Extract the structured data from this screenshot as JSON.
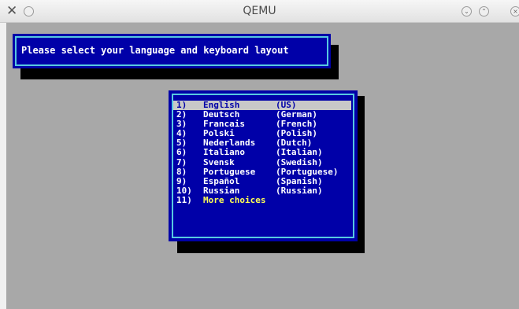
{
  "window": {
    "title": "QEMU",
    "icons": [
      "close-icon",
      "minimize-circle-icon",
      "chevron-down-icon",
      "chevron-up-icon",
      "close-circle-icon"
    ]
  },
  "header": {
    "prompt": "Please select your language and keyboard layout"
  },
  "menu": {
    "selected_index": 0,
    "items": [
      {
        "number": "1)",
        "label": "English",
        "detail": "(US)"
      },
      {
        "number": "2)",
        "label": "Deutsch",
        "detail": "(German)"
      },
      {
        "number": "3)",
        "label": "Francais",
        "detail": "(French)"
      },
      {
        "number": "4)",
        "label": "Polski",
        "detail": "(Polish)"
      },
      {
        "number": "5)",
        "label": "Nederlands",
        "detail": "(Dutch)"
      },
      {
        "number": "6)",
        "label": "Italiano",
        "detail": "(Italian)"
      },
      {
        "number": "7)",
        "label": "Svensk",
        "detail": "(Swedish)"
      },
      {
        "number": "8)",
        "label": "Portuguese",
        "detail": "(Portuguese)"
      },
      {
        "number": "9)",
        "label": "Español",
        "detail": "(Spanish)"
      },
      {
        "number": "10)",
        "label": "Russian",
        "detail": "(Russian)"
      },
      {
        "number": "11)",
        "label": "More choices",
        "detail": ""
      }
    ]
  },
  "colors": {
    "screen_bg": "#a8a8a8",
    "dialog_bg": "#0000a8",
    "border": "#57c8e0",
    "text": "#ffffff",
    "highlight": "#ffff55",
    "selected_bg": "#c8c8c8"
  }
}
